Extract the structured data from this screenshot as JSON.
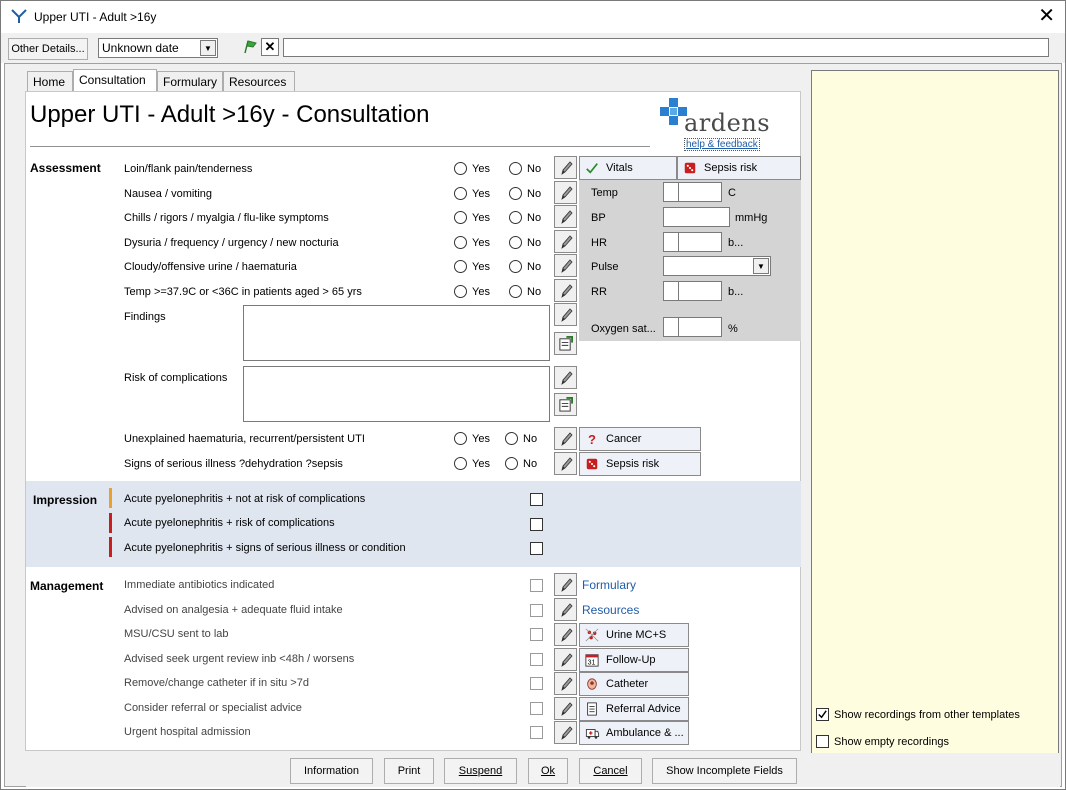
{
  "window": {
    "title": "Upper UTI - Adult >16y"
  },
  "toolbar": {
    "other_details_label": "Other Details...",
    "date_value": "Unknown date",
    "free_text_value": ""
  },
  "tabs": [
    {
      "label": "Home"
    },
    {
      "label": "Consultation"
    },
    {
      "label": "Formulary"
    },
    {
      "label": "Resources"
    }
  ],
  "page": {
    "heading": "Upper UTI - Adult >16y - Consultation"
  },
  "brand": {
    "name": "ardens",
    "help_link": "help & feedback"
  },
  "assessment": {
    "section_label": "Assessment",
    "yes_label": "Yes",
    "no_label": "No",
    "questions": [
      "Loin/flank pain/tenderness",
      "Nausea / vomiting",
      "Chills / rigors / myalgia / flu-like symptoms",
      "Dysuria / frequency / urgency / new nocturia",
      "Cloudy/offensive urine / haematuria",
      "Temp >=37.9C or <36C in patients aged > 65 yrs"
    ],
    "findings_label": "Findings",
    "risk_label": "Risk of complications",
    "extra_questions": [
      "Unexplained haematuria, recurrent/persistent UTI",
      "Signs of serious illness ?dehydration ?sepsis"
    ],
    "cancer_button": "Cancer",
    "sepsis_button": "Sepsis risk"
  },
  "vitals": {
    "vitals_tab": "Vitals",
    "sepsis_tab": "Sepsis risk",
    "temp_label": "Temp",
    "temp_unit": "C",
    "bp_label": "BP",
    "bp_unit": "mmHg",
    "hr_label": "HR",
    "hr_unit": "b...",
    "pulse_label": "Pulse",
    "rr_label": "RR",
    "rr_unit": "b...",
    "oxygen_label": "Oxygen sat...",
    "oxygen_unit": "%"
  },
  "impression": {
    "section_label": "Impression",
    "items": [
      "Acute pyelonephritis + not at risk of complications",
      "Acute pyelonephritis + risk of complications",
      "Acute pyelonephritis + signs of serious illness or condition"
    ],
    "bar_colors": [
      "#e8a030",
      "#c81e1e",
      "#c81e1e"
    ]
  },
  "management": {
    "section_label": "Management",
    "items": [
      "Immediate antibiotics indicated",
      "Advised on analgesia + adequate fluid intake",
      "MSU/CSU sent to lab",
      "Advised seek urgent review inb <48h / worsens",
      "Remove/change catheter if in situ >7d",
      "Consider referral or specialist advice",
      "Urgent hospital admission"
    ],
    "formulary_link": "Formulary",
    "resources_link": "Resources",
    "buttons": [
      "Urine MC+S",
      "Follow-Up",
      "Catheter",
      "Referral Advice",
      "Ambulance & ..."
    ]
  },
  "right_panel": {
    "show_other_label": "Show recordings from other templates",
    "show_other_checked": true,
    "show_empty_label": "Show empty recordings",
    "show_empty_checked": false
  },
  "bottom": {
    "information": "Information",
    "print": "Print",
    "suspend": "Suspend",
    "ok": "Ok",
    "cancel": "Cancel",
    "show_incomplete": "Show Incomplete Fields"
  },
  "colors": {
    "link": "#1f5da8",
    "impression_bg": "#dfe6f0",
    "panel_bg": "#fffde0",
    "brand_blue": "#2a7fd0"
  }
}
